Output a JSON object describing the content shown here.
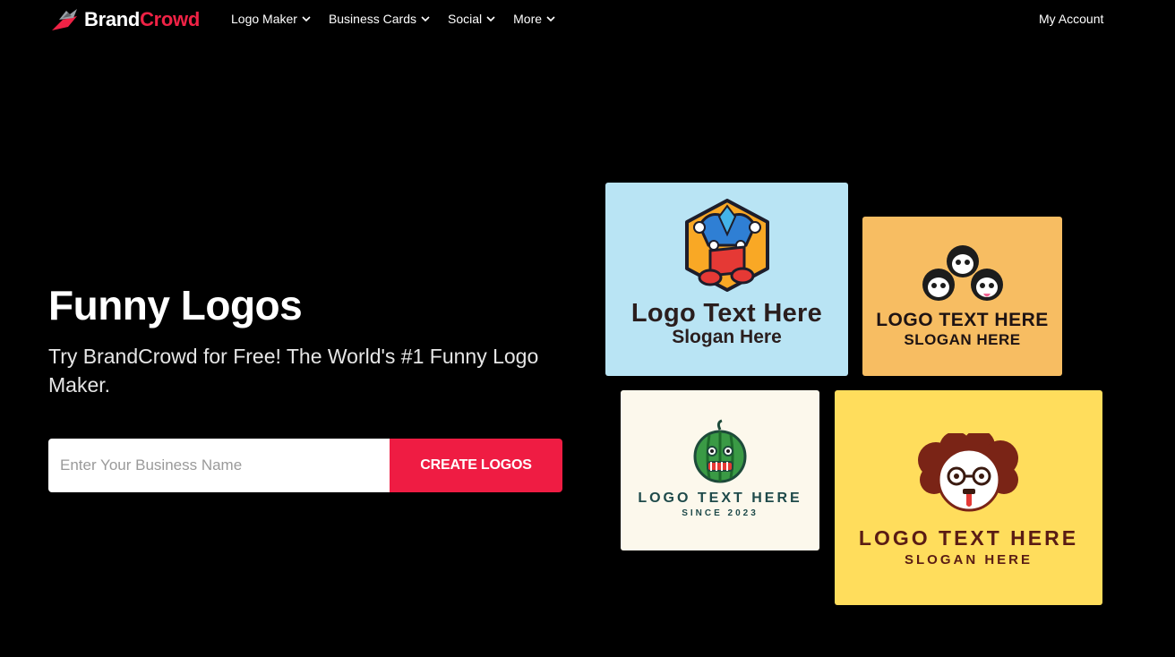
{
  "header": {
    "brand_part1": "Brand",
    "brand_part2": "Crowd",
    "menu": [
      {
        "label": "Logo Maker"
      },
      {
        "label": "Business Cards"
      },
      {
        "label": "Social"
      },
      {
        "label": "More"
      }
    ],
    "account_label": "My Account"
  },
  "hero": {
    "title": "Funny Logos",
    "subtitle": "Try BrandCrowd for Free! The World's #1 Funny Logo Maker.",
    "input_placeholder": "Enter Your Business Name",
    "cta_label": "CREATE LOGOS"
  },
  "cards": [
    {
      "icon": "jester-music-icon",
      "logo_text": "Logo Text Here",
      "slogan": "Slogan Here",
      "bg": "#b9e4f4"
    },
    {
      "icon": "three-monkeys-icon",
      "logo_text": "LOGO TEXT HERE",
      "slogan": "SLOGAN HERE",
      "bg": "#f7bd62"
    },
    {
      "icon": "watermelon-face-icon",
      "logo_text": "LOGO TEXT HERE",
      "slogan": "SINCE 2023",
      "bg": "#fcf8ec"
    },
    {
      "icon": "curly-nerd-face-icon",
      "logo_text": "LOGO TEXT HERE",
      "slogan": "SLOGAN HERE",
      "bg": "#ffdd5c"
    }
  ],
  "colors": {
    "background": "#000000",
    "accent": "#ef1c43"
  }
}
